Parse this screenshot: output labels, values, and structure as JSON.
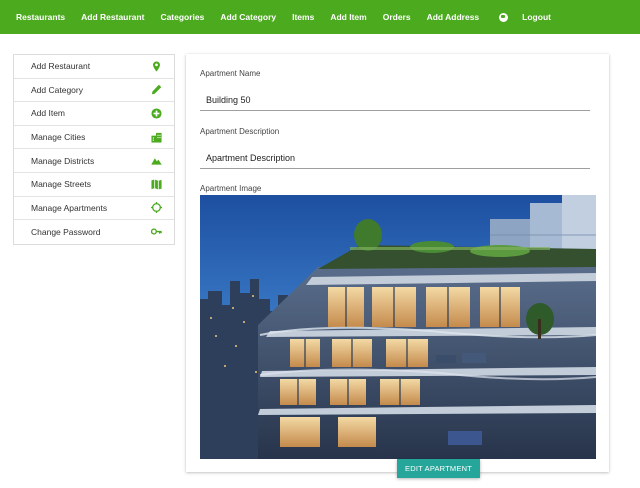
{
  "navbar": {
    "items": [
      {
        "label": "Restaurants"
      },
      {
        "label": "Add Restaurant"
      },
      {
        "label": "Categories"
      },
      {
        "label": "Add Category"
      },
      {
        "label": "Items"
      },
      {
        "label": "Add Item"
      },
      {
        "label": "Orders"
      },
      {
        "label": "Add Address"
      }
    ],
    "globe_icon": "globe-icon",
    "logout_label": "Logout",
    "background_color": "#4caa1e"
  },
  "sidebar": {
    "items": [
      {
        "label": "Add Restaurant",
        "icon": "map-marker-icon"
      },
      {
        "label": "Add Category",
        "icon": "pencil-icon"
      },
      {
        "label": "Add Item",
        "icon": "plus-circle-icon"
      },
      {
        "label": "Manage Cities",
        "icon": "building-icon"
      },
      {
        "label": "Manage Districts",
        "icon": "mountain-icon"
      },
      {
        "label": "Manage Streets",
        "icon": "map-icon"
      },
      {
        "label": "Manage Apartments",
        "icon": "target-icon"
      },
      {
        "label": "Change Password",
        "icon": "key-icon"
      }
    ],
    "icon_color": "#4caa1e"
  },
  "form": {
    "name_label": "Apartment Name",
    "name_value": "Building 50",
    "description_label": "Apartment Description",
    "description_value": "Apartment Description",
    "image_label": "Apartment Image",
    "submit_label": "EDIT APARTMENT",
    "button_color": "#26a69a"
  }
}
